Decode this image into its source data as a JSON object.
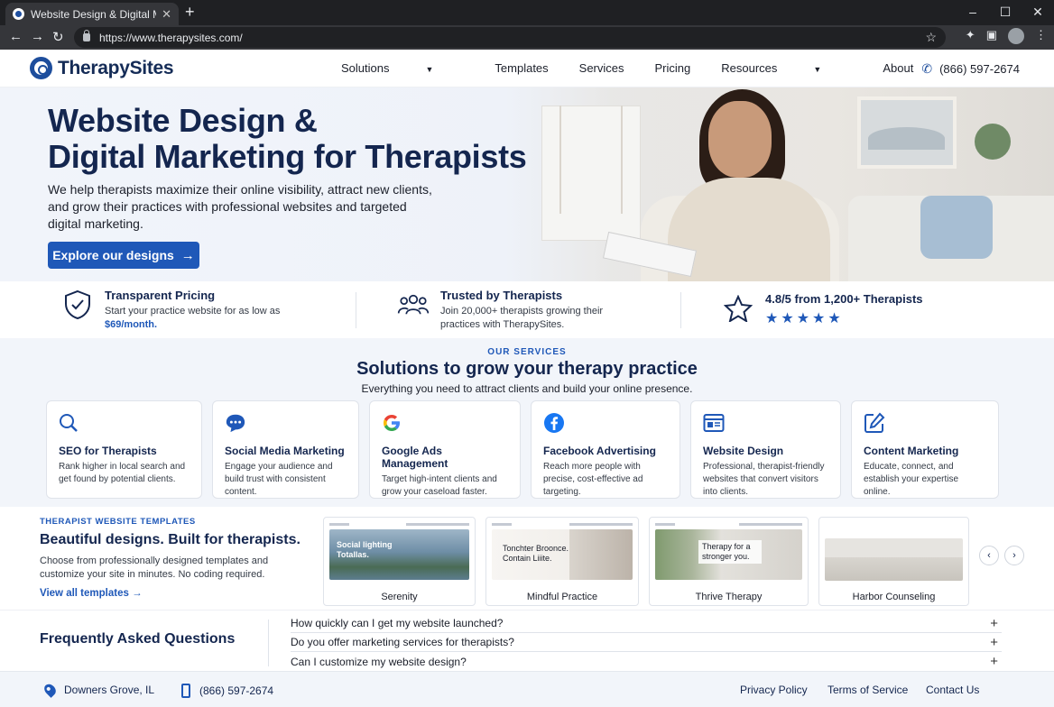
{
  "browser": {
    "tab_title": "Website Design & Digital Mark...",
    "url": "https://www.therapysites.com/"
  },
  "header": {
    "logo": "TherapySites",
    "nav": [
      "Solutions",
      "Templates",
      "Services",
      "Pricing",
      "Resources",
      "About"
    ],
    "phone": "(866) 597-2674"
  },
  "hero": {
    "title_line1": "Website Design &",
    "title_line2": "Digital Marketing for Therapists",
    "body": "We help therapists maximize their online visibility, attract new clients, and grow their practices with professional websites and targeted digital marketing.",
    "cta": "Explore our designs"
  },
  "trust": {
    "pricing_title": "Transparent Pricing",
    "pricing_text": "Start your practice website for as low as",
    "pricing_price": "$69/month.",
    "trusted_title": "Trusted by Therapists",
    "trusted_text": "Join 20,000+ therapists growing their practices with TherapySites.",
    "rating_title": "4.8/5 from 1,200+ Therapists",
    "stars": "★★★★★"
  },
  "services": {
    "eyebrow": "OUR SERVICES",
    "title": "Solutions to grow your therapy practice",
    "lead": "Everything you need to attract clients and build your online presence.",
    "cards": [
      {
        "title": "SEO for Therapists",
        "text": "Rank higher in local search and get found by potential clients.",
        "icon": "search-icon"
      },
      {
        "title": "Social Media Marketing",
        "text": "Engage your audience and build trust with consistent content.",
        "icon": "chat-icon"
      },
      {
        "title": "Google Ads Management",
        "text": "Target high-intent clients and grow your caseload faster.",
        "icon": "google-icon"
      },
      {
        "title": "Facebook Advertising",
        "text": "Reach more people with precise, cost-effective ad targeting.",
        "icon": "facebook-icon"
      },
      {
        "title": "Website Design",
        "text": "Professional, therapist-friendly websites that convert visitors into clients.",
        "icon": "layout-icon"
      },
      {
        "title": "Content Marketing",
        "text": "Educate, connect, and establish your expertise online.",
        "icon": "edit-icon"
      }
    ]
  },
  "templates": {
    "eyebrow": "THERAPIST WEBSITE TEMPLATES",
    "title": "Beautiful designs. Built for therapists.",
    "text": "Choose from professionally designed templates and customize your site in minutes. No coding required.",
    "link": "View all templates",
    "items": [
      {
        "name": "Serenity",
        "overlay": "Social lighting Totallas."
      },
      {
        "name": "Mindful Practice",
        "overlay": "Tonchter Broonce. Contain Liiite."
      },
      {
        "name": "Thrive Therapy",
        "overlay": "Therapy for a stronger you."
      },
      {
        "name": "Harbor Counseling",
        "overlay": ""
      }
    ]
  },
  "faq": {
    "title": "Frequently Asked Questions",
    "questions": [
      "How quickly can I get my website launched?",
      "Do you offer marketing services for therapists?",
      "Can I customize my website design?"
    ]
  },
  "footer": {
    "location": "Downers Grove, IL",
    "phone": "(866) 597-2674",
    "links": [
      "Privacy Policy",
      "Terms of Service",
      "Contact Us"
    ]
  },
  "colors": {
    "brand_navy": "#14264f",
    "brand_blue": "#1f58b8"
  }
}
